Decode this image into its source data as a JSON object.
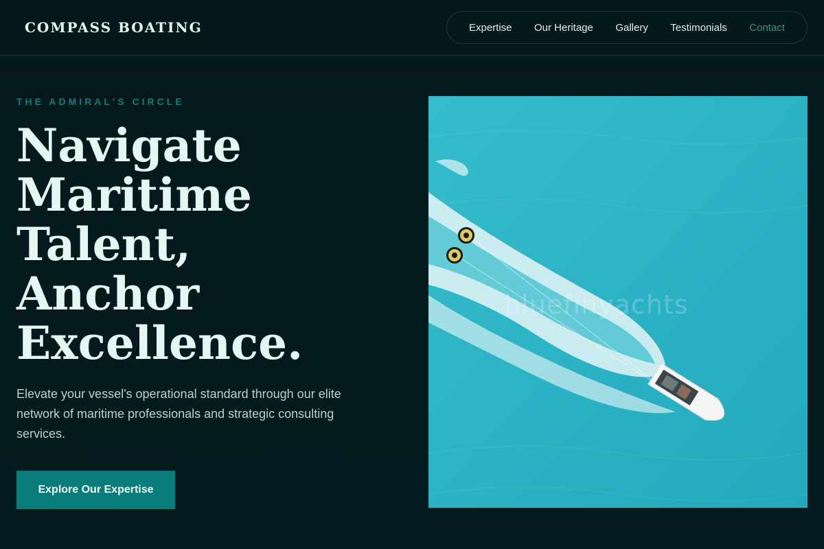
{
  "header": {
    "brand": "COMPASS BOATING",
    "nav": [
      {
        "label": "Expertise"
      },
      {
        "label": "Our Heritage"
      },
      {
        "label": "Gallery"
      },
      {
        "label": "Testimonials"
      },
      {
        "label": "Contact"
      }
    ]
  },
  "hero": {
    "kicker": "THE ADMIRAL'S CIRCLE",
    "headline_lines": [
      "Navigate",
      "Maritime",
      "Talent,",
      "Anchor",
      "Excellence."
    ],
    "subtext": "Elevate your vessel's operational standard through our elite network of maritime professionals and strategic consulting services.",
    "cta_label": "Explore Our Expertise"
  },
  "image": {
    "watermark": "bluefinyachts",
    "content": "aerial-speedboat-towing-inflatables"
  },
  "colors": {
    "background": "#041c1e",
    "accent": "#0a7c7a",
    "kicker": "#1a7a78",
    "water": "#2fb7c8"
  }
}
